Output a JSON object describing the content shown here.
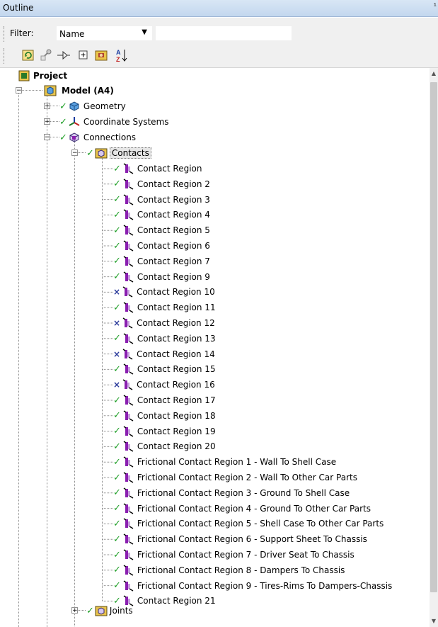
{
  "panel": {
    "title": "Outline",
    "pin": "¹"
  },
  "filter": {
    "label": "Filter:",
    "selected": "Name",
    "text_value": "",
    "arrow": "▼"
  },
  "toolbar": {
    "buttons": [
      {
        "name": "refresh-icon",
        "glyph": "↻"
      },
      {
        "name": "graphics-icon",
        "glyph": "⚙"
      },
      {
        "name": "move-icon",
        "glyph": "⫘"
      },
      {
        "name": "expand-all-icon",
        "glyph": "⊞"
      },
      {
        "name": "folder-icon",
        "glyph": "▣"
      },
      {
        "name": "sort-az-icon",
        "glyph": "A↓"
      }
    ]
  },
  "tree": {
    "project": {
      "label": "Project"
    },
    "model": {
      "label": "Model (A4)"
    },
    "geometry": {
      "label": "Geometry"
    },
    "coordinate_systems": {
      "label": "Coordinate Systems"
    },
    "connections": {
      "label": "Connections"
    },
    "contacts": {
      "label": "Contacts"
    },
    "contact_items": [
      {
        "label": "Contact Region",
        "status": "ok"
      },
      {
        "label": "Contact Region 2",
        "status": "ok"
      },
      {
        "label": "Contact Region 3",
        "status": "ok"
      },
      {
        "label": "Contact Region 4",
        "status": "ok"
      },
      {
        "label": "Contact Region 5",
        "status": "ok"
      },
      {
        "label": "Contact Region 6",
        "status": "ok"
      },
      {
        "label": "Contact Region 7",
        "status": "ok"
      },
      {
        "label": "Contact Region 9",
        "status": "ok"
      },
      {
        "label": "Contact Region 10",
        "status": "suppressed"
      },
      {
        "label": "Contact Region 11",
        "status": "ok"
      },
      {
        "label": "Contact Region 12",
        "status": "suppressed"
      },
      {
        "label": "Contact Region 13",
        "status": "ok"
      },
      {
        "label": "Contact Region 14",
        "status": "suppressed"
      },
      {
        "label": "Contact Region 15",
        "status": "ok"
      },
      {
        "label": "Contact Region 16",
        "status": "suppressed"
      },
      {
        "label": "Contact Region 17",
        "status": "ok"
      },
      {
        "label": "Contact Region 18",
        "status": "ok"
      },
      {
        "label": "Contact Region 19",
        "status": "ok"
      },
      {
        "label": "Contact Region 20",
        "status": "ok"
      },
      {
        "label": "Frictional Contact Region 1 - Wall To Shell Case",
        "status": "ok"
      },
      {
        "label": "Frictional Contact Region 2 - Wall To Other Car Parts",
        "status": "ok"
      },
      {
        "label": "Frictional Contact Region 3 - Ground To Shell Case",
        "status": "ok"
      },
      {
        "label": "Frictional Contact Region 4 - Ground To Other Car Parts",
        "status": "ok"
      },
      {
        "label": "Frictional Contact Region 5 - Shell Case To Other Car Parts",
        "status": "ok"
      },
      {
        "label": "Frictional Contact Region 6 - Support Sheet To Chassis",
        "status": "ok"
      },
      {
        "label": "Frictional Contact Region 7 - Driver Seat To Chassis",
        "status": "ok"
      },
      {
        "label": "Frictional Contact Region 8 - Dampers To Chassis",
        "status": "ok"
      },
      {
        "label": "Frictional Contact Region 9 - Tires-Rims To Dampers-Chassis",
        "status": "ok"
      },
      {
        "label": "Contact Region 21",
        "status": "ok"
      }
    ],
    "joints": {
      "label": "Joints"
    },
    "status_glyphs": {
      "ok": "✓",
      "suppressed": "×"
    },
    "expander": {
      "plus": "+",
      "minus": "−"
    }
  },
  "colors": {
    "ok": "#22a02a",
    "suppressed": "#2a3a9a",
    "contact_purple": "#8a1fb0"
  }
}
